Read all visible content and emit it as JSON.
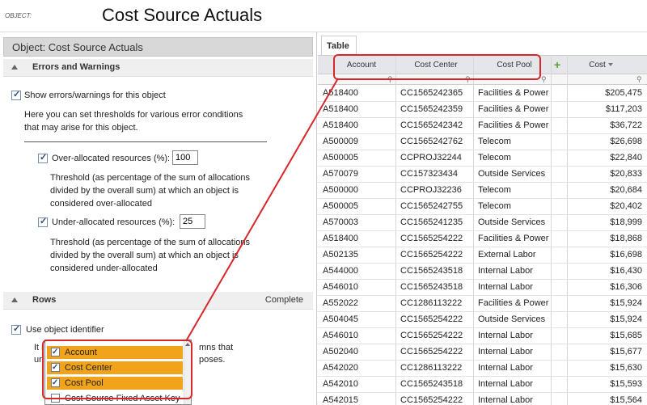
{
  "header": {
    "object_label": "OBJECT:",
    "title": "Cost Source Actuals"
  },
  "left_panel": {
    "title": "Object: Cost Source Actuals",
    "errors_section": {
      "title": "Errors and Warnings",
      "show_errors_label": "Show errors/warnings for this object",
      "desc_line1": "Here you can set thresholds for various error conditions",
      "desc_line2": "that may arise for this object.",
      "over_label": "Over-allocated resources (%):",
      "over_value": "100",
      "over_desc1": "Threshold (as percentage of the sum of allocations",
      "over_desc2": "divided by the overall sum) at which an object is",
      "over_desc3": "considered over-allocated",
      "under_label": "Under-allocated resources (%):",
      "under_value": "25",
      "under_desc1": "Threshold (as percentage of the sum of allocations",
      "under_desc2": "divided by the overall sum) at which an object is",
      "under_desc3": "considered under-allocated"
    },
    "rows_section": {
      "title": "Rows",
      "status": "Complete",
      "use_identifier_label": "Use object identifier",
      "partial_line1_a": "It i",
      "partial_line1_b": "mns that",
      "partial_line2_a": "un",
      "partial_line2_b": "poses."
    },
    "dropdown_items": [
      {
        "label": "Account",
        "checked": true
      },
      {
        "label": "Cost Center",
        "checked": true
      },
      {
        "label": "Cost Pool",
        "checked": true
      },
      {
        "label": "Cost Source Fixed Asset Key",
        "checked": false
      }
    ]
  },
  "table": {
    "tab_label": "Table",
    "columns": [
      "Account",
      "Cost Center",
      "Cost Pool",
      "Cost"
    ],
    "rows": [
      [
        "A518400",
        "CC1565242365",
        "Facilities & Power",
        "$205,475"
      ],
      [
        "A518400",
        "CC1565242359",
        "Facilities & Power",
        "$117,203"
      ],
      [
        "A518400",
        "CC1565242342",
        "Facilities & Power",
        "$36,722"
      ],
      [
        "A500009",
        "CC1565242762",
        "Telecom",
        "$26,698"
      ],
      [
        "A500005",
        "CCPROJ32244",
        "Telecom",
        "$22,840"
      ],
      [
        "A570079",
        "CC157323434",
        "Outside Services",
        "$20,833"
      ],
      [
        "A500000",
        "CCPROJ32236",
        "Telecom",
        "$20,684"
      ],
      [
        "A500005",
        "CC1565242755",
        "Telecom",
        "$20,402"
      ],
      [
        "A570003",
        "CC1565241235",
        "Outside Services",
        "$18,999"
      ],
      [
        "A518400",
        "CC1565254222",
        "Facilities & Power",
        "$18,868"
      ],
      [
        "A502135",
        "CC1565254222",
        "External Labor",
        "$16,698"
      ],
      [
        "A544000",
        "CC1565243518",
        "Internal Labor",
        "$16,430"
      ],
      [
        "A546010",
        "CC1565243518",
        "Internal Labor",
        "$16,306"
      ],
      [
        "A552022",
        "CC1286113222",
        "Facilities & Power",
        "$15,924"
      ],
      [
        "A504045",
        "CC1565254222",
        "Outside Services",
        "$15,924"
      ],
      [
        "A546010",
        "CC1565254222",
        "Internal Labor",
        "$15,685"
      ],
      [
        "A502040",
        "CC1565254222",
        "Internal Labor",
        "$15,677"
      ],
      [
        "A542020",
        "CC1286113222",
        "Internal Labor",
        "$15,630"
      ],
      [
        "A542010",
        "CC1565243518",
        "Internal Labor",
        "$15,593"
      ],
      [
        "A542015",
        "CC1565254222",
        "Internal Labor",
        "$15,564"
      ]
    ]
  },
  "colors": {
    "callout": "#d7272b",
    "selection": "#f2a31c",
    "plus": "#5aa02c"
  }
}
